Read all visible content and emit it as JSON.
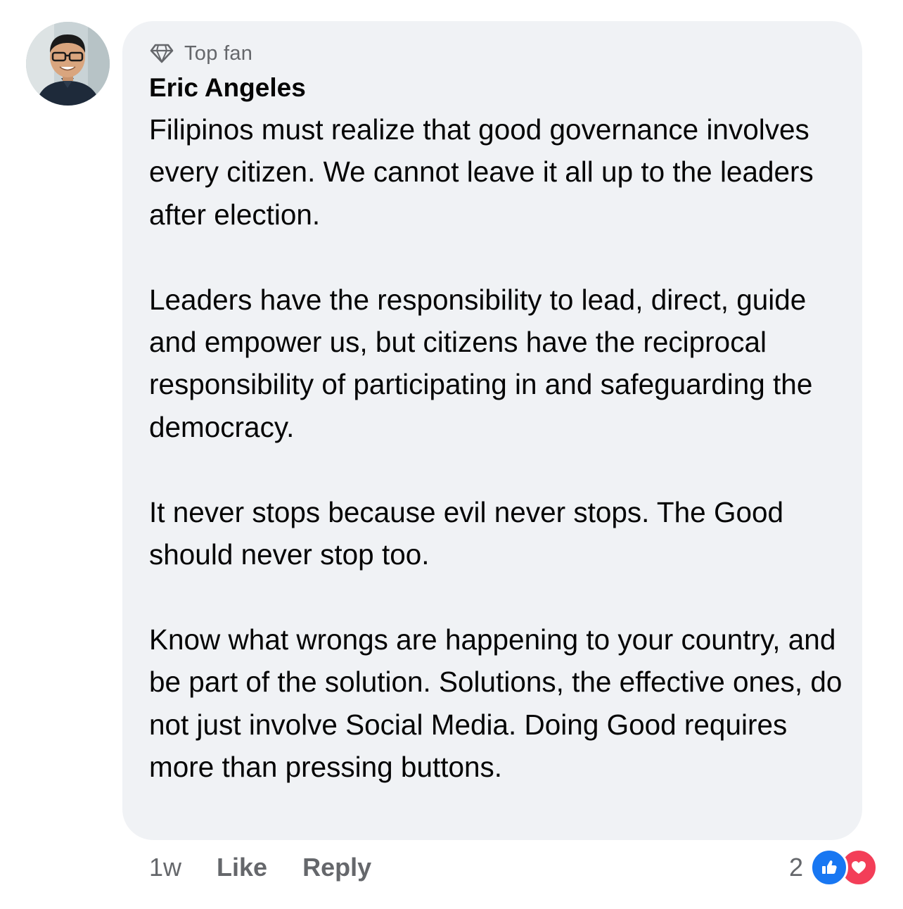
{
  "comment": {
    "badge": {
      "icon": "diamond-icon",
      "label": "Top fan"
    },
    "author": "Eric Angeles",
    "paragraphs": [
      "Filipinos must realize that good governance involves every citizen. We cannot leave it all up to the leaders after election.",
      "Leaders have the responsibility to lead, direct, guide and empower us, but citizens have the reciprocal responsibility of participating in and safeguarding the democracy.",
      "It never stops because evil never stops. The Good should never stop too.",
      "Know what wrongs are happening to your country, and be part of the solution. Solutions, the effective ones, do not just involve Social Media. Doing Good requires more than pressing buttons."
    ]
  },
  "actions": {
    "timestamp": "1w",
    "like_label": "Like",
    "reply_label": "Reply"
  },
  "reactions": {
    "count": "2",
    "icons": [
      "like-reaction-icon",
      "love-reaction-icon"
    ]
  },
  "colors": {
    "bubble": "#f0f2f5",
    "secondary_text": "#65676b",
    "like_blue": "#1877f2",
    "love_red": "#f33e58"
  }
}
